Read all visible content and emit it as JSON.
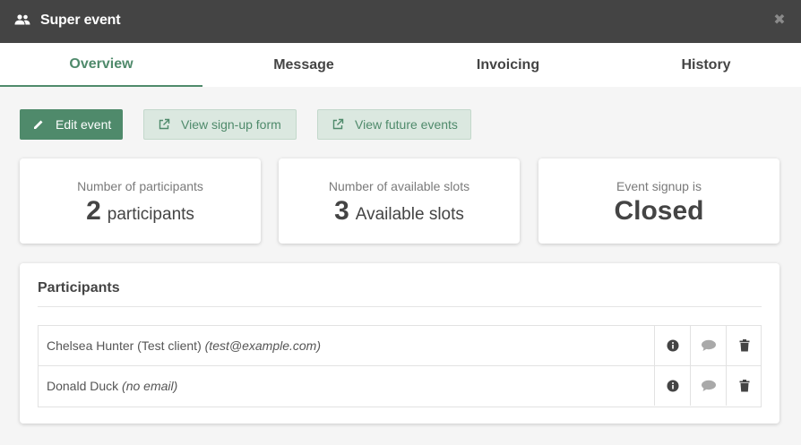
{
  "window": {
    "title": "Super event",
    "icon": "people-icon",
    "close_icon": "close-icon"
  },
  "tabs": [
    {
      "label": "Overview",
      "active": true
    },
    {
      "label": "Message",
      "active": false
    },
    {
      "label": "Invoicing",
      "active": false
    },
    {
      "label": "History",
      "active": false
    }
  ],
  "actions": {
    "edit": {
      "label": "Edit event",
      "icon": "pencil-icon"
    },
    "signup_form": {
      "label": "View sign-up form",
      "icon": "external-link-icon"
    },
    "future_events": {
      "label": "View future events",
      "icon": "external-link-icon"
    }
  },
  "stats": {
    "participants": {
      "label": "Number of participants",
      "value": "2",
      "unit": "participants"
    },
    "slots": {
      "label": "Number of available slots",
      "value": "3",
      "unit": "Available slots"
    },
    "signup": {
      "label": "Event signup is",
      "status": "Closed"
    }
  },
  "participants": {
    "title": "Participants",
    "rows": [
      {
        "name": "Chelsea Hunter (Test client)",
        "email": "(test@example.com)"
      },
      {
        "name": "Donald Duck",
        "email": "(no email)"
      }
    ]
  },
  "colors": {
    "accent": "#4f8a6b",
    "titlebar": "#444444",
    "background": "#f5f5f5"
  }
}
